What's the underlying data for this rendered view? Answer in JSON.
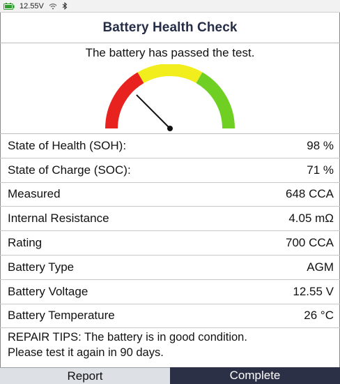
{
  "status_bar": {
    "battery_icon": "battery-status-icon",
    "voltage": "12.55V",
    "wifi_icon": "wifi-icon",
    "bluetooth_icon": "bluetooth-icon"
  },
  "header": {
    "title": "Battery Health Check"
  },
  "result": {
    "message": "The battery has passed the test.",
    "gauge": {
      "zones": [
        {
          "name": "red",
          "color": "#e8231f"
        },
        {
          "name": "yellow",
          "color": "#f2ee1d"
        },
        {
          "name": "green",
          "color": "#6fcf22"
        }
      ],
      "needle_fraction": 0.25
    }
  },
  "rows": [
    {
      "label": "State of Health (SOH):",
      "value": "98 %"
    },
    {
      "label": "State of Charge (SOC):",
      "value": "71 %"
    },
    {
      "label": "Measured",
      "value": "648 CCA"
    },
    {
      "label": "Internal Resistance",
      "value": "4.05 mΩ"
    },
    {
      "label": "Rating",
      "value": "700 CCA"
    },
    {
      "label": "Battery Type",
      "value": "AGM"
    },
    {
      "label": "Battery Voltage",
      "value": "12.55 V"
    },
    {
      "label": "Battery Temperature",
      "value": "26 °C"
    }
  ],
  "tips": {
    "line1": "REPAIR TIPS: The battery is in good condition.",
    "line2": "Please test it again in 90 days."
  },
  "footer": {
    "report_label": "Report",
    "complete_label": "Complete"
  },
  "colors": {
    "header_text": "#262d47",
    "complete_bg": "#2c3046",
    "report_bg": "#dde1e6"
  }
}
